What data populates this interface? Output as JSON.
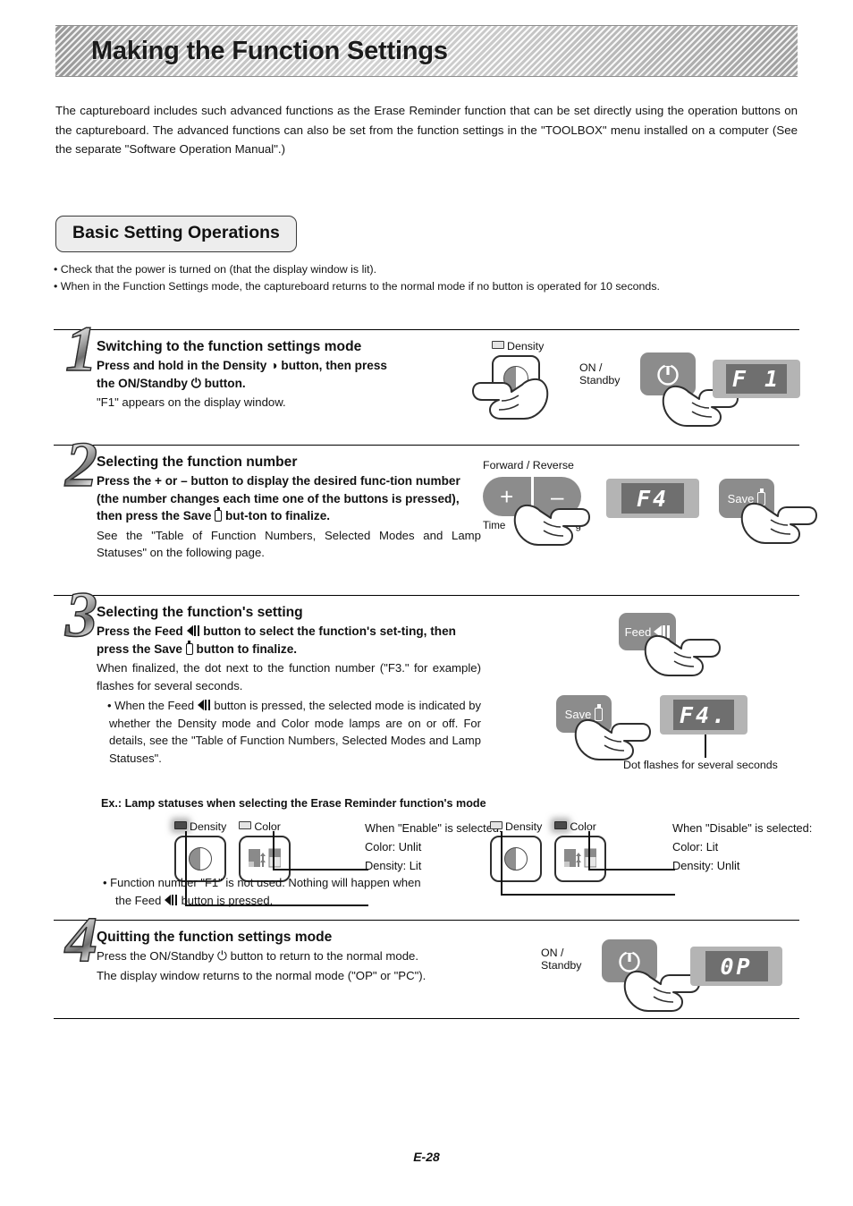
{
  "header": {
    "title": "Making the Function Settings"
  },
  "intro": {
    "text": "The captureboard includes such advanced functions as the Erase Reminder function that can be set directly using the operation buttons on the captureboard. The advanced functions can also be set from the function settings in the \"TOOLBOX\" menu installed on a computer (See the separate \"Software Operation Manual\".)"
  },
  "section": {
    "title": "Basic Setting Operations",
    "bullets": [
      "• Check that the power is turned on (that the display window is lit).",
      "• When in the Function Settings mode, the captureboard returns to the normal mode if no button is operated for 10 seconds."
    ]
  },
  "steps": [
    {
      "number": "1",
      "title": "Switching to the function settings mode",
      "lead_a": "Press and hold in the Density",
      "lead_b": "button, then press",
      "lead_c": "the ON/Standby",
      "lead_d": "button.",
      "note": "\"F1\" appears on the display window.",
      "diagram": {
        "density_label": "Density",
        "onstandby_label_1": "ON /",
        "onstandby_label_2": "Standby",
        "lcd": "F 1"
      }
    },
    {
      "number": "2",
      "title": "Selecting the function number",
      "lead_a": "Press the + or – button to display the desired func-tion number (the number changes each time one of the buttons is pressed), then press the Save",
      "lead_b": "but-ton to finalize.",
      "note": "See the \"Table of Function Numbers, Selected Modes and Lamp Statuses\" on the following page.",
      "diagram": {
        "forward_reverse": "Forward / Reverse",
        "plus": "+",
        "minus": "–",
        "time_left": "Time",
        "time_right": "g",
        "lcd": "F4",
        "save_label": "Save"
      }
    },
    {
      "number": "3",
      "title": "Selecting the function's setting",
      "lead_a": "Press the Feed",
      "lead_b": "button to select the function's set-ting, then press the Save",
      "lead_c": "button to finalize.",
      "note": "When finalized, the dot next to the function number (\"F3.\" for example) flashes for several seconds.",
      "sub_a": "• When the Feed",
      "sub_b": "button is pressed, the selected mode is indicated by whether the Density mode and Color mode lamps are on or off. For details, see the \"Table of Function Numbers, Selected Modes and Lamp Statuses\".",
      "diagram": {
        "feed_label": "Feed",
        "save_label": "Save",
        "lcd": "F4.",
        "dot_caption": "Dot flashes for several seconds"
      },
      "example": {
        "heading": "Ex.: Lamp statuses when selecting the Erase Reminder function's mode",
        "left": {
          "density_label": "Density",
          "color_label": "Color",
          "caption": "When \"Enable\" is selected:",
          "line1": "Color: Unlit",
          "line2": "Density: Lit",
          "density_lit": true,
          "color_lit": false
        },
        "right": {
          "density_label": "Density",
          "color_label": "Color",
          "caption": "When \"Disable\" is selected:",
          "line1": "Color: Lit",
          "line2": "Density: Unlit",
          "density_lit": false,
          "color_lit": true
        }
      },
      "footnote_a": "• Function number \"F1\" is not used. Nothing will happen when",
      "footnote_b": "the Feed",
      "footnote_c": "button is pressed."
    },
    {
      "number": "4",
      "title": "Quitting the function settings mode",
      "lead_a": "Press the ON/Standby",
      "lead_b": "button to return to the normal mode.",
      "note": "The display window returns to the normal mode (\"OP\" or \"PC\").",
      "diagram": {
        "onstandby_label_1": "ON /",
        "onstandby_label_2": "Standby",
        "lcd": "0P"
      }
    }
  ],
  "footer": {
    "page": "E-28"
  },
  "colors": {
    "lcd_bezel": "#b4b4b4",
    "lcd_screen": "#6f6f6f",
    "key_gray": "#8c8c8c",
    "lamp_lit": "#4a4a4a",
    "lamp_unlit": "#e4e4e4"
  }
}
